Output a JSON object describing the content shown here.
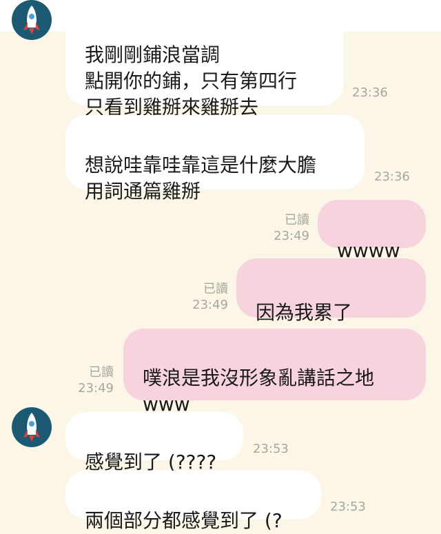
{
  "chat": {
    "messages": [
      {
        "side": "in",
        "text": "我剛剛鋪浪當調\n點開你的鋪，只有第四行\n只看到雞掰來雞掰去",
        "time": "23:36"
      },
      {
        "side": "in",
        "text": "想說哇靠哇靠這是什麼大膽\n用詞通篇雞掰",
        "time": "23:36"
      },
      {
        "side": "out",
        "text": "wwww",
        "read": "已讀",
        "time": "23:49"
      },
      {
        "side": "out",
        "text": "因為我累了",
        "read": "已讀",
        "time": "23:49",
        "sticker": "crying-cat-icon"
      },
      {
        "side": "out",
        "text": "噗浪是我沒形象亂講話之地\nwww",
        "read": "已讀",
        "time": "23:49"
      },
      {
        "side": "in",
        "text": "感覺到了 (????",
        "time": "23:53"
      },
      {
        "side": "in",
        "text": "兩個部分都感覺到了 (?",
        "time": "23:53"
      }
    ]
  },
  "colors": {
    "background": "#fbf6e6",
    "incoming_bubble": "#ffffff",
    "outgoing_bubble": "#f7d4dd",
    "avatar": "#1c5a73",
    "meta_text": "#a9a69e"
  }
}
